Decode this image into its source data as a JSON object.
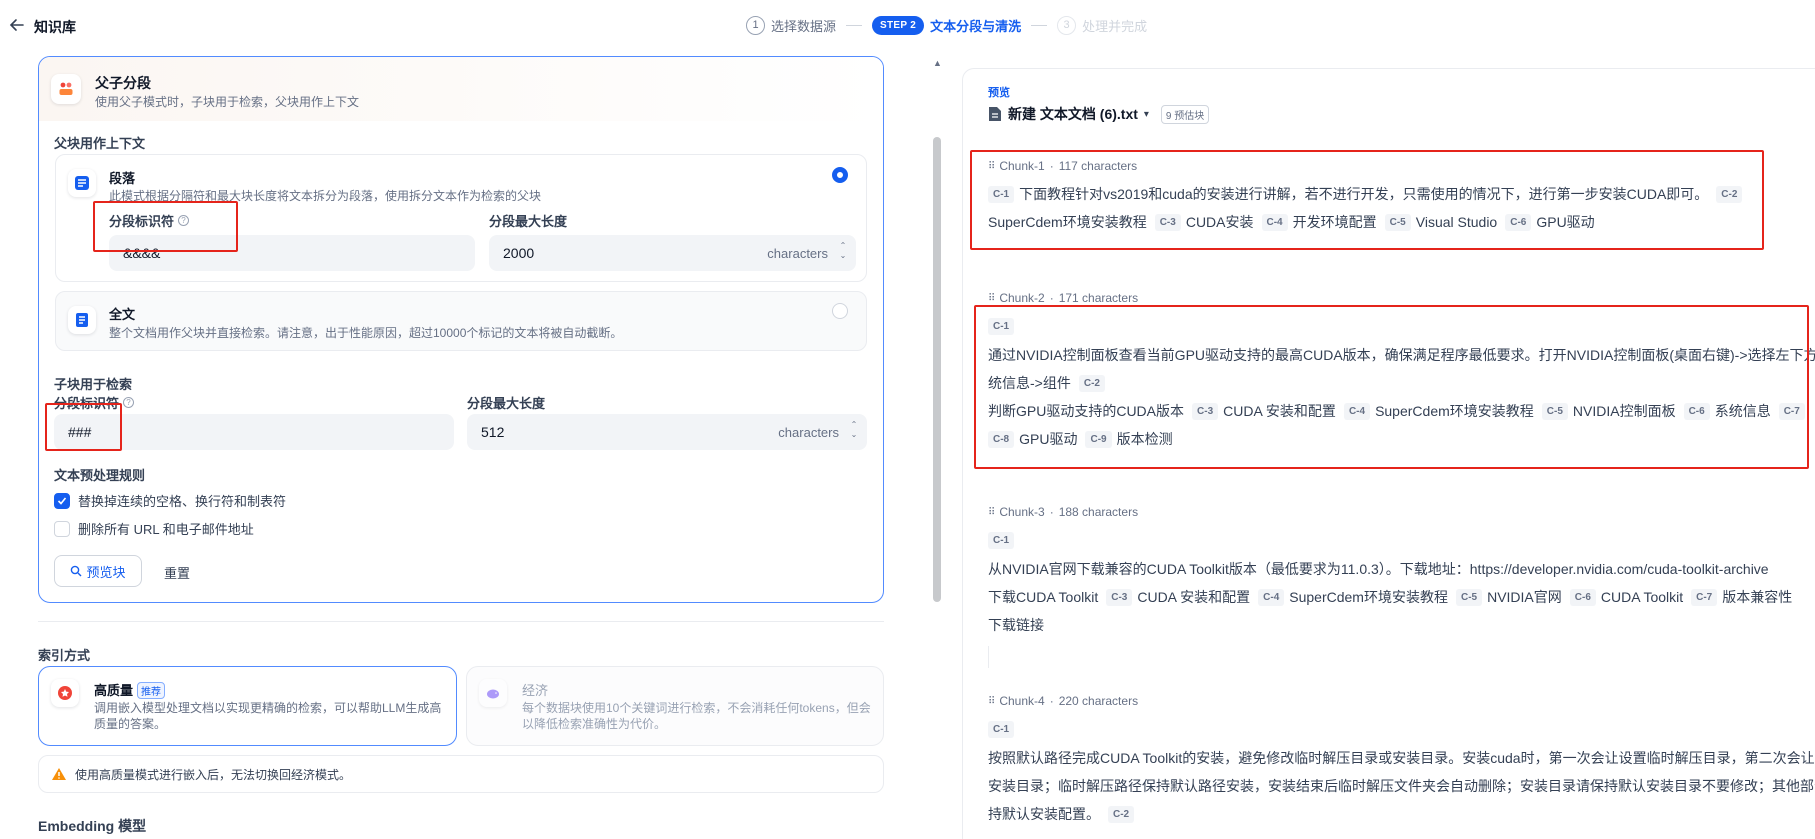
{
  "header": {
    "title": "知识库",
    "steps": [
      {
        "num": "1",
        "label": "选择数据源"
      },
      {
        "pill": "STEP 2",
        "label": "文本分段与清洗"
      },
      {
        "num": "3",
        "label": "处理并完成"
      }
    ]
  },
  "parent_child": {
    "title": "父子分段",
    "desc": "使用父子模式时，子块用于检索，父块用作上下文",
    "parent_section": "父块用作上下文",
    "paragraph": {
      "title": "段落",
      "desc": "此模式根据分隔符和最大块长度将文本拆分为段落，使用拆分文本作为检索的父块",
      "delimiter_label": "分段标识符",
      "delimiter_value": "&&&&",
      "maxlen_label": "分段最大长度",
      "maxlen_value": "2000",
      "unit": "characters"
    },
    "fulltext": {
      "title": "全文",
      "desc": "整个文档用作父块并直接检索。请注意，出于性能原因，超过10000个标记的文本将被自动截断。"
    },
    "child_section": "子块用于检索",
    "child": {
      "delimiter_label": "分段标识符",
      "delimiter_value": "###",
      "maxlen_label": "分段最大长度",
      "maxlen_value": "512",
      "unit": "characters"
    },
    "preprocess_label": "文本预处理规则",
    "rules": [
      {
        "label": "替换掉连续的空格、换行符和制表符",
        "checked": true
      },
      {
        "label": "删除所有 URL 和电子邮件地址",
        "checked": false
      }
    ],
    "preview_button": "预览块",
    "reset_button": "重置"
  },
  "index": {
    "label": "索引方式",
    "high_quality": {
      "title": "高质量",
      "badge": "推荐",
      "desc": "调用嵌入模型处理文档以实现更精确的检索，可以帮助LLM生成高质量的答案。"
    },
    "economy": {
      "title": "经济",
      "desc": "每个数据块使用10个关键词进行检索，不会消耗任何tokens，但会以降低检索准确性为代价。"
    },
    "warning": "使用高质量模式进行嵌入后，无法切换回经济模式。",
    "embedding_label": "Embedding 模型"
  },
  "preview": {
    "label": "预览",
    "doc_name": "新建 文本文档 (6).txt",
    "count": "9 预估块",
    "chunks": [
      {
        "id": "Chunk-1",
        "chars": "117 characters",
        "lines": [
          [
            [
              "C-1",
              "下面教程针对vs2019和cuda的安装进行讲解，若不进行开发，只需使用的情况下，进行第一步安装CUDA即可。"
            ],
            [
              "C-2",
              ""
            ]
          ],
          [
            [
              "",
              "SuperCdem环境安装教程"
            ],
            [
              "C-3",
              "CUDA安装"
            ],
            [
              "C-4",
              "开发环境配置"
            ],
            [
              "C-5",
              "Visual Studio"
            ],
            [
              "C-6",
              "GPU驱动"
            ]
          ]
        ]
      },
      {
        "id": "Chunk-2",
        "chars": "171 characters",
        "lines": [
          [
            [
              "C-1",
              ""
            ]
          ],
          [
            [
              "",
              "通过NVIDIA控制面板查看当前GPU驱动支持的最高CUDA版本，确保满足程序最低要求。打开NVIDIA控制面板(桌面右键)->选择左下方"
            ]
          ],
          [
            [
              "",
              "统信息->组件"
            ],
            [
              "C-2",
              ""
            ]
          ],
          [
            [
              "",
              "判断GPU驱动支持的CUDA版本"
            ],
            [
              "C-3",
              "CUDA 安装和配置"
            ],
            [
              "C-4",
              "SuperCdem环境安装教程"
            ],
            [
              "C-5",
              "NVIDIA控制面板"
            ],
            [
              "C-6",
              "系统信息"
            ],
            [
              "C-7",
              ""
            ]
          ],
          [
            [
              "C-8",
              "GPU驱动"
            ],
            [
              "C-9",
              "版本检测"
            ]
          ]
        ]
      },
      {
        "id": "Chunk-3",
        "chars": "188 characters",
        "lines": [
          [
            [
              "C-1",
              ""
            ]
          ],
          [
            [
              "",
              "从NVIDIA官网下载兼容的CUDA Toolkit版本（最低要求为11.0.3）。下载地址：https://developer.nvidia.com/cuda-toolkit-archive"
            ]
          ],
          [
            [
              "",
              "下载CUDA Toolkit"
            ],
            [
              "C-3",
              "CUDA 安装和配置"
            ],
            [
              "C-4",
              "SuperCdem环境安装教程"
            ],
            [
              "C-5",
              "NVIDIA官网"
            ],
            [
              "C-6",
              "CUDA Toolkit"
            ],
            [
              "C-7",
              "版本兼容性"
            ]
          ],
          [
            [
              "",
              "下载链接"
            ]
          ]
        ]
      },
      {
        "id": "Chunk-4",
        "chars": "220 characters",
        "lines": [
          [
            [
              "C-1",
              ""
            ]
          ],
          [
            [
              "",
              "按照默认路径完成CUDA Toolkit的安装，避免修改临时解压目录或安装目录。安装cuda时，第一次会让设置临时解压目录，第二次会让"
            ]
          ],
          [
            [
              "",
              "安装目录；临时解压路径保持默认路径安装，安装结束后临时解压文件夹会自动删除；安装目录请保持默认安装目录不要修改；其他部分"
            ]
          ],
          [
            [
              "",
              "持默认安装配置。"
            ],
            [
              "C-2",
              ""
            ]
          ]
        ]
      }
    ]
  },
  "colors": {
    "accent": "#155eef",
    "highlight_box": "#e5241b",
    "warning": "#f79009"
  }
}
